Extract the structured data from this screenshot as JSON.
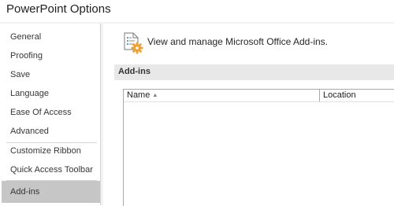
{
  "window": {
    "title": "PowerPoint Options"
  },
  "sidebar": {
    "items": [
      {
        "label": "General",
        "selected": false
      },
      {
        "label": "Proofing",
        "selected": false
      },
      {
        "label": "Save",
        "selected": false
      },
      {
        "label": "Language",
        "selected": false
      },
      {
        "label": "Ease Of Access",
        "selected": false
      },
      {
        "label": "Advanced",
        "selected": false
      },
      {
        "label": "Customize Ribbon",
        "selected": false
      },
      {
        "label": "Quick Access Toolbar",
        "selected": false
      },
      {
        "label": "Add-ins",
        "selected": true
      }
    ]
  },
  "main": {
    "header_icon": "addins-document-gear-icon",
    "header_text": "View and manage Microsoft Office Add-ins.",
    "section_title": "Add-ins",
    "table": {
      "columns": [
        {
          "label": "Name",
          "sort": "ascending"
        },
        {
          "label": "Location"
        }
      ],
      "sort_arrow": "▲",
      "rows": []
    }
  },
  "colors": {
    "selected_nav_bg": "#c6c6c6",
    "section_bar_bg": "#e8e8e8",
    "icon_accent": "#f0a030"
  }
}
